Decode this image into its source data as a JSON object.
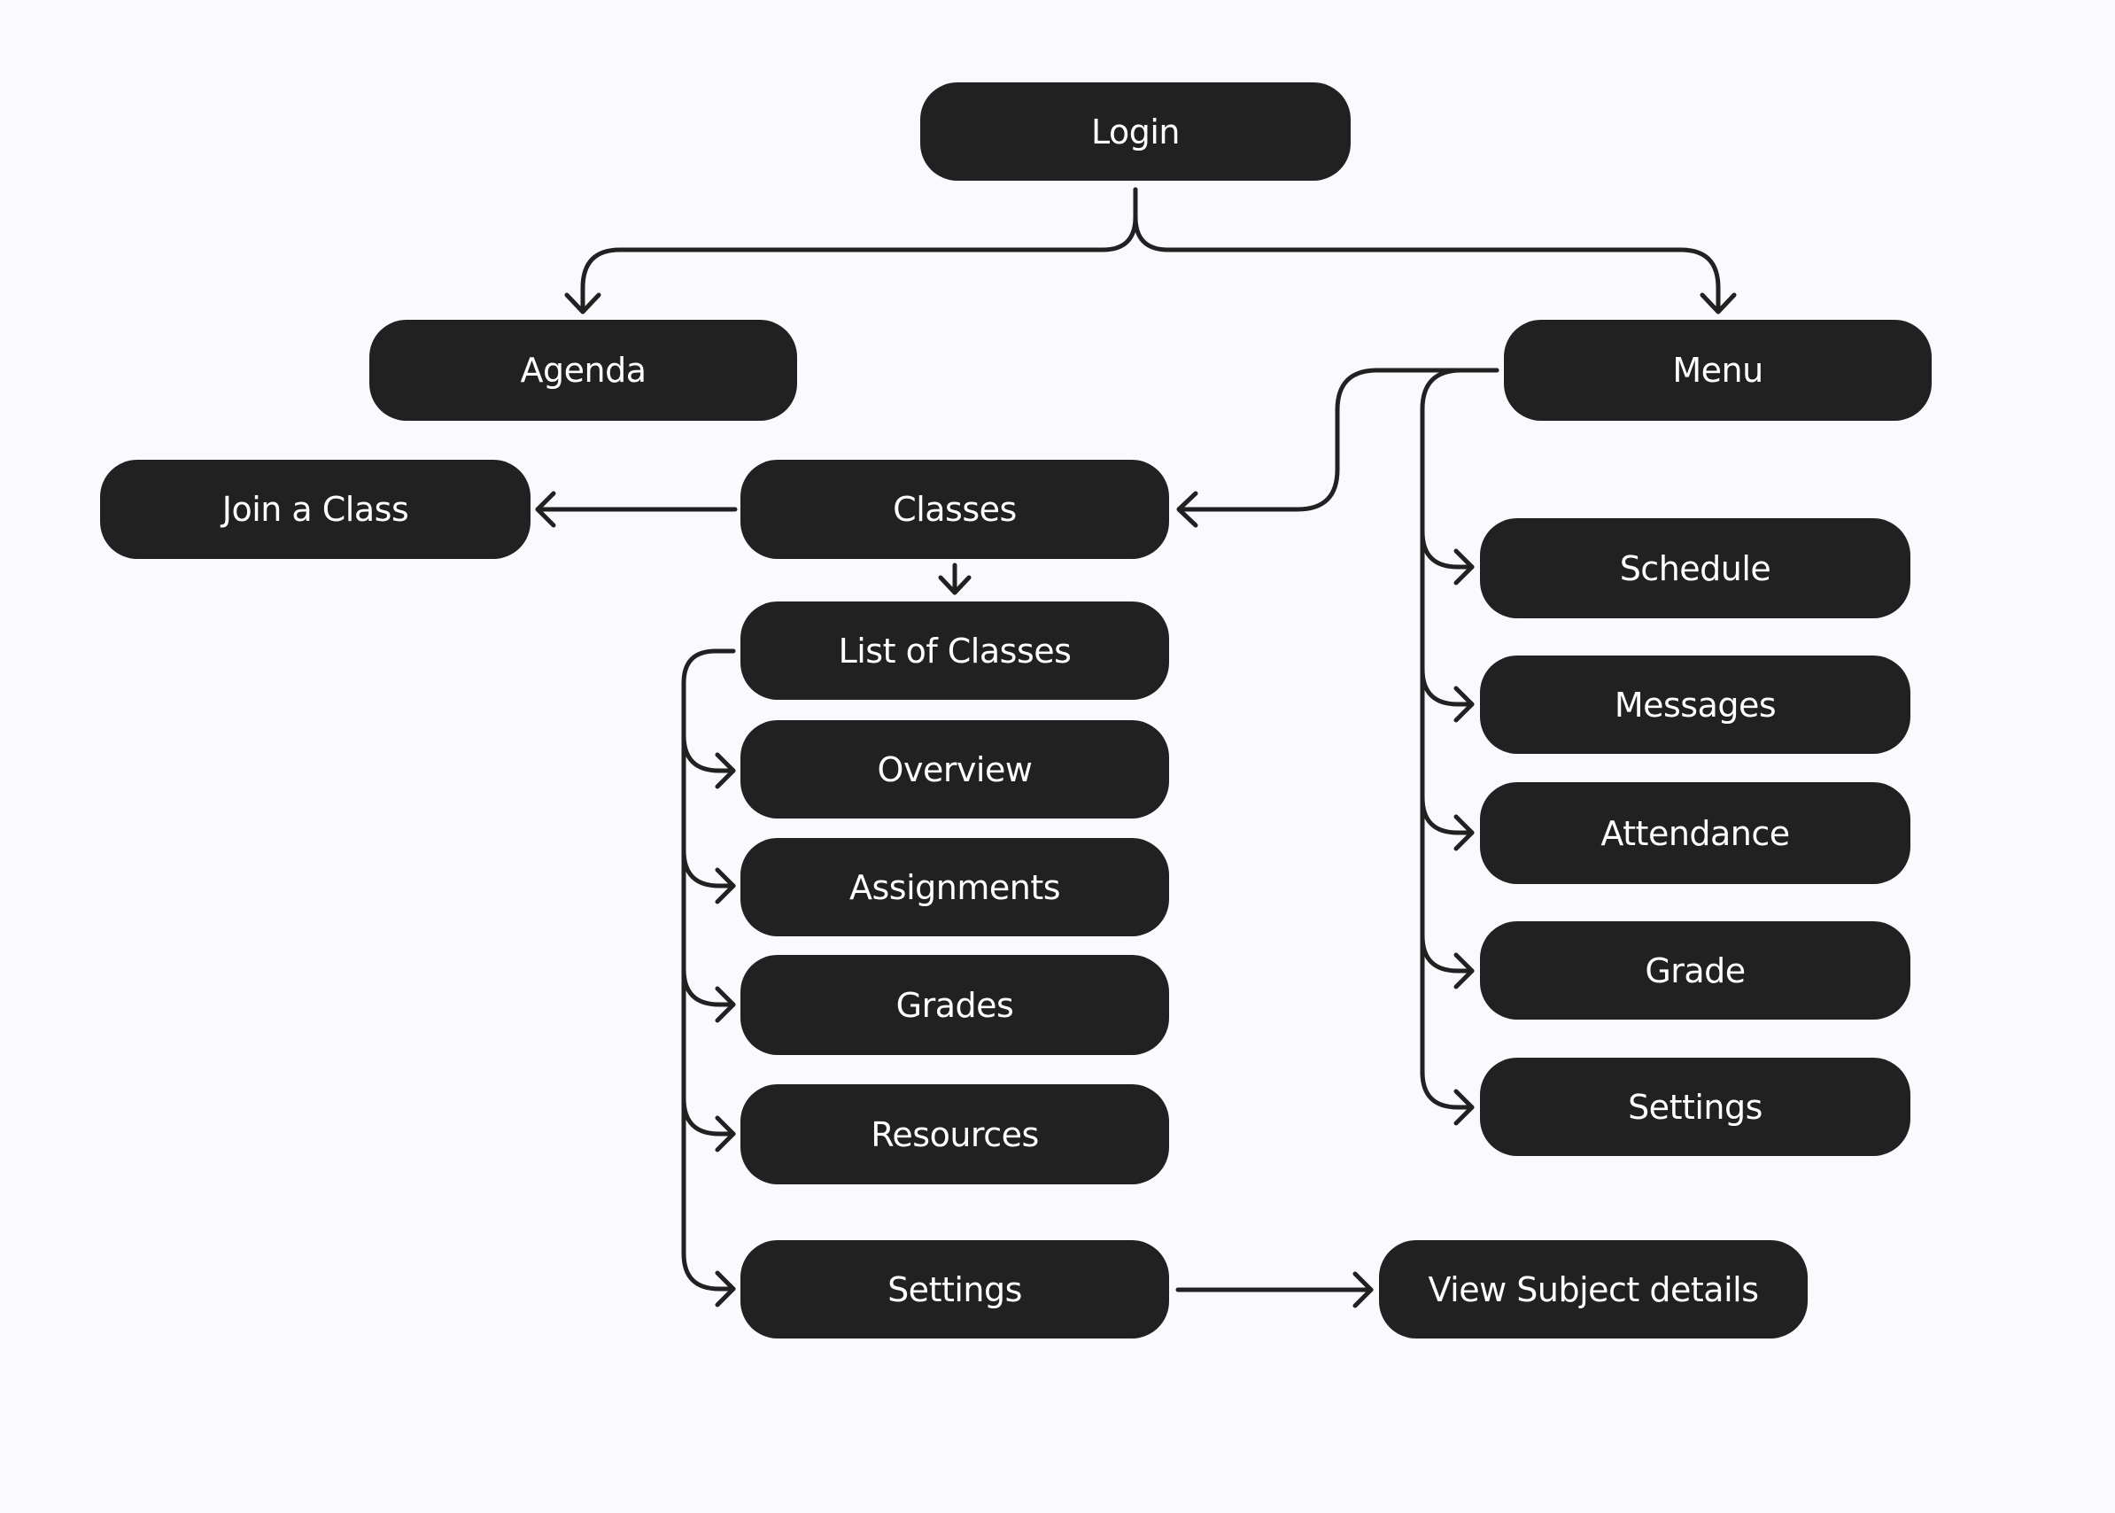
{
  "diagram": {
    "type": "sitemap",
    "colors": {
      "background": "#f9f9fe",
      "node_fill": "#212121",
      "node_text": "#ffffff",
      "connector": "#212121"
    },
    "nodes": {
      "login": "Login",
      "agenda": "Agenda",
      "menu": "Menu",
      "join_class": "Join a Class",
      "classes": "Classes",
      "list_of_classes": "List of Classes",
      "overview": "Overview",
      "assignments": "Assignments",
      "grades": "Grades",
      "resources": "Resources",
      "class_settings": "Settings",
      "view_subject_details": "View Subject details",
      "schedule": "Schedule",
      "messages": "Messages",
      "attendance": "Attendance",
      "grade": "Grade",
      "menu_settings": "Settings"
    },
    "edges": [
      {
        "from": "Login",
        "to": "Agenda"
      },
      {
        "from": "Login",
        "to": "Menu"
      },
      {
        "from": "Menu",
        "to": "Classes"
      },
      {
        "from": "Menu",
        "to": "Schedule"
      },
      {
        "from": "Menu",
        "to": "Messages"
      },
      {
        "from": "Menu",
        "to": "Attendance"
      },
      {
        "from": "Menu",
        "to": "Grade"
      },
      {
        "from": "Menu",
        "to": "Settings"
      },
      {
        "from": "Classes",
        "to": "Join a Class"
      },
      {
        "from": "Classes",
        "to": "List of Classes"
      },
      {
        "from": "List of Classes",
        "to": "Overview"
      },
      {
        "from": "List of Classes",
        "to": "Assignments"
      },
      {
        "from": "List of Classes",
        "to": "Grades"
      },
      {
        "from": "List of Classes",
        "to": "Resources"
      },
      {
        "from": "List of Classes",
        "to": "Settings"
      },
      {
        "from": "Settings",
        "to": "View Subject details"
      }
    ]
  }
}
